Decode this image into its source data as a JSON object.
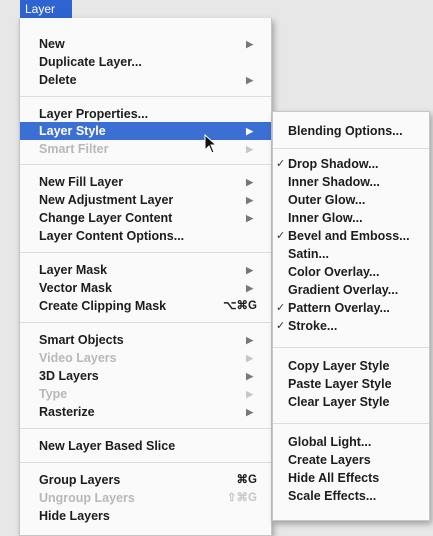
{
  "menubar": {
    "title": "Layer"
  },
  "menu": {
    "items": [
      {
        "label": "New",
        "arrow": "▶"
      },
      {
        "label": "Duplicate Layer..."
      },
      {
        "label": "Delete",
        "arrow": "▶"
      },
      {
        "label": "Layer Properties..."
      },
      {
        "label": "Layer Style",
        "arrow": "▶",
        "highlighted": true
      },
      {
        "label": "Smart Filter",
        "arrow": "▶",
        "disabled": true
      },
      {
        "label": "New Fill Layer",
        "arrow": "▶"
      },
      {
        "label": "New Adjustment Layer",
        "arrow": "▶"
      },
      {
        "label": "Change Layer Content",
        "arrow": "▶"
      },
      {
        "label": "Layer Content Options..."
      },
      {
        "label": "Layer Mask",
        "arrow": "▶"
      },
      {
        "label": "Vector Mask",
        "arrow": "▶"
      },
      {
        "label": "Create Clipping Mask",
        "shortcut": "⌥⌘G"
      },
      {
        "label": "Smart Objects",
        "arrow": "▶"
      },
      {
        "label": "Video Layers",
        "arrow": "▶",
        "disabled": true
      },
      {
        "label": "3D Layers",
        "arrow": "▶"
      },
      {
        "label": "Type",
        "arrow": "▶",
        "disabled": true
      },
      {
        "label": "Rasterize",
        "arrow": "▶"
      },
      {
        "label": "New Layer Based Slice"
      },
      {
        "label": "Group Layers",
        "shortcut": "⌘G"
      },
      {
        "label": "Ungroup Layers",
        "shortcut": "⇧⌘G",
        "disabled": true
      },
      {
        "label": "Hide Layers"
      }
    ]
  },
  "submenu": {
    "items": [
      {
        "label": "Blending Options..."
      },
      {
        "label": "Drop Shadow...",
        "checked": true
      },
      {
        "label": "Inner Shadow..."
      },
      {
        "label": "Outer Glow..."
      },
      {
        "label": "Inner Glow..."
      },
      {
        "label": "Bevel and Emboss...",
        "checked": true
      },
      {
        "label": "Satin..."
      },
      {
        "label": "Color Overlay..."
      },
      {
        "label": "Gradient Overlay..."
      },
      {
        "label": "Pattern Overlay...",
        "checked": true
      },
      {
        "label": "Stroke...",
        "checked": true
      },
      {
        "label": "Copy Layer Style"
      },
      {
        "label": "Paste Layer Style"
      },
      {
        "label": "Clear Layer Style"
      },
      {
        "label": "Global Light..."
      },
      {
        "label": "Create Layers"
      },
      {
        "label": "Hide All Effects"
      },
      {
        "label": "Scale Effects..."
      }
    ],
    "check_mark": "✓"
  },
  "colors": {
    "highlight": "#3b6fd4",
    "menubar": "#2f63d2",
    "disabled_text": "#b8b8b8"
  }
}
